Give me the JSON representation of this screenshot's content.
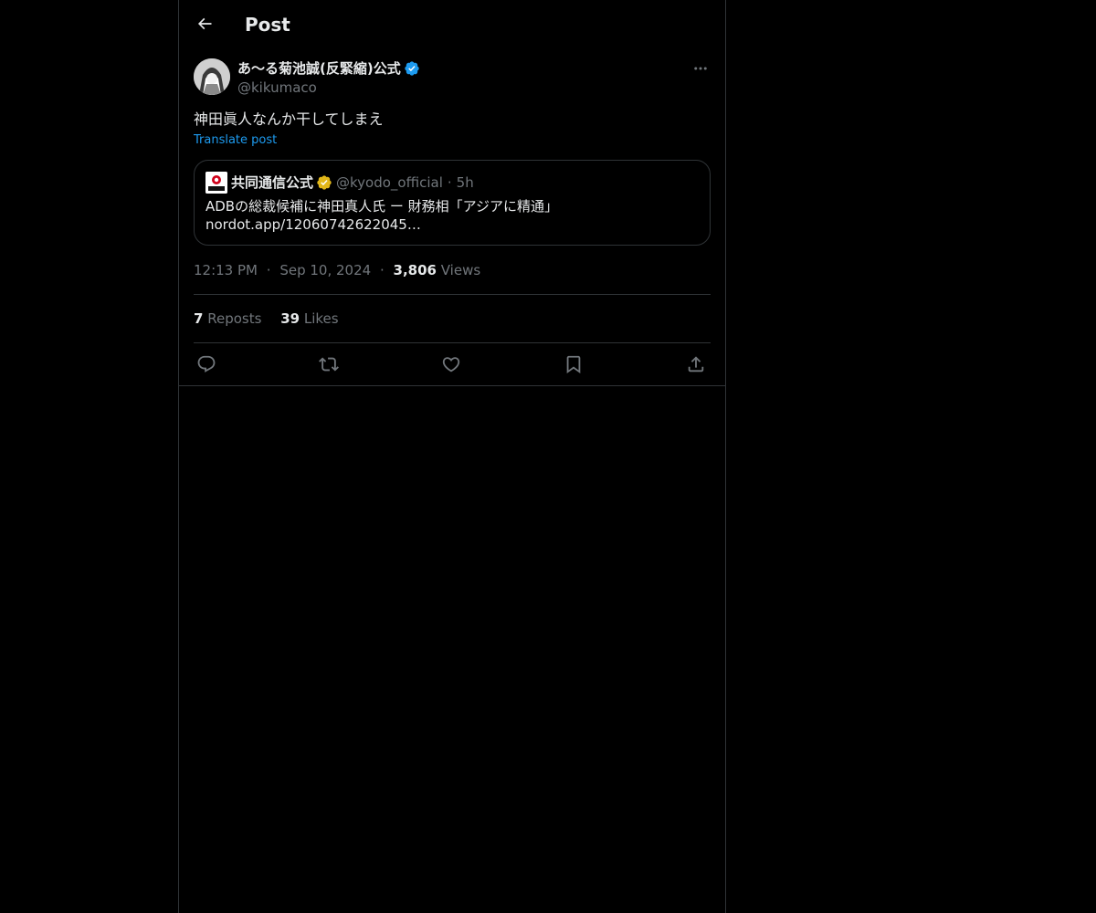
{
  "header": {
    "title": "Post",
    "back_icon": "arrow-left-icon"
  },
  "post": {
    "author": {
      "display_name": "あ〜る菊池誠(反緊縮)公式",
      "handle": "@kikumaco",
      "verified_color": "#1d9bf0"
    },
    "text": "神田眞人なんか干してしまえ",
    "translate_label": "Translate post",
    "quote": {
      "display_name": "共同通信公式",
      "handle": "@kyodo_official",
      "separator": "·",
      "time": "5h",
      "verified_color": "#e2b719",
      "text_line1": "ADBの総裁候補に神田真人氏 ー 財務相「アジアに精通」",
      "text_line2": "nordot.app/12060742622045…"
    },
    "meta": {
      "time": "12:13 PM",
      "separator": "·",
      "date": "Sep 10, 2024",
      "views_count": "3,806",
      "views_label": "Views"
    },
    "stats": {
      "reposts_count": "7",
      "reposts_label": "Reposts",
      "likes_count": "39",
      "likes_label": "Likes"
    },
    "actions": [
      "reply-icon",
      "repost-icon",
      "like-icon",
      "bookmark-icon",
      "share-icon"
    ]
  },
  "colors": {
    "background": "#000000",
    "text_primary": "#e7e9ea",
    "text_secondary": "#71767b",
    "accent": "#1d9bf0",
    "border": "#2f3336"
  }
}
